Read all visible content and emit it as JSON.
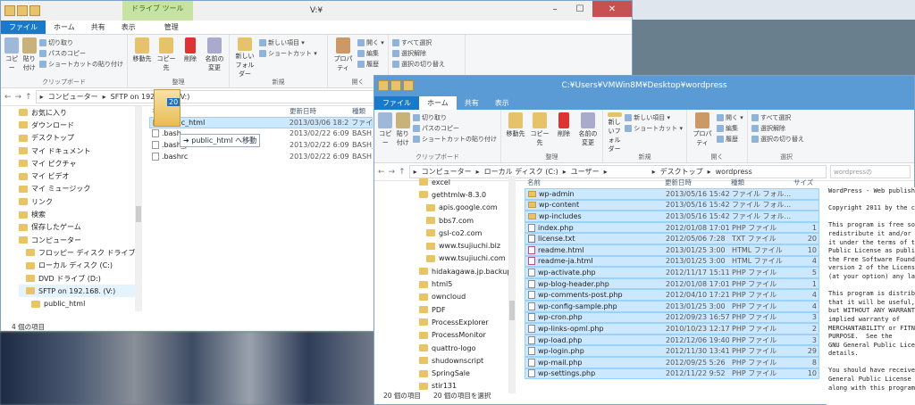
{
  "desktop_blur": "",
  "w1": {
    "title": "V:¥",
    "ctx_tab": "ドライブ ツール",
    "tabs": [
      "ファイル",
      "ホーム",
      "共有",
      "表示",
      "管理"
    ],
    "ribbon": {
      "copy": "コピー",
      "paste": "貼り付け",
      "cut": "切り取り",
      "copy_path": "パスのコピー",
      "paste_shortcut": "ショートカットの貼り付け",
      "move_to": "移動先",
      "copy_to": "コピー先",
      "delete": "削除",
      "rename": "名前の変更",
      "new_folder": "新しいフォルダー",
      "new_item": "新しい項目 ▾",
      "shortcut": "ショートカット ▾",
      "properties": "プロパティ",
      "open": "開く ▾",
      "edit": "編集",
      "history": "履歴",
      "select_all": "すべて選択",
      "select_none": "選択解除",
      "invert": "選択の切り替え",
      "grp_clipboard": "クリップボード",
      "grp_organize": "整理",
      "grp_new": "新規",
      "grp_open": "開く",
      "grp_select": "選択"
    },
    "path": [
      "コンピューター",
      "SFTP on 192.168.",
      "(V:)"
    ],
    "nav": [
      {
        "label": "お気に入り"
      },
      {
        "label": "ダウンロード"
      },
      {
        "label": "デスクトップ"
      },
      {
        "label": "マイ ドキュメント"
      },
      {
        "label": "マイ ピクチャ"
      },
      {
        "label": "マイ ビデオ"
      },
      {
        "label": "マイ ミュージック"
      },
      {
        "label": "リンク"
      },
      {
        "label": "検索"
      },
      {
        "label": "保存したゲーム"
      },
      {
        "label": "コンピューター"
      },
      {
        "label": "フロッピー ディスク ドライブ (A"
      },
      {
        "label": "ローカル ディスク (C:)"
      },
      {
        "label": "DVD ドライブ (D:)"
      },
      {
        "label": "SFTP on 192.168.       (V:)"
      },
      {
        "label": "public_html"
      }
    ],
    "cols": [
      "名前",
      "更新日時",
      "種類"
    ],
    "files": [
      {
        "name": "public_html",
        "date": "2013/03/06 18:20",
        "type": "ファイ",
        "kind": "folder",
        "sel": true
      },
      {
        "name": ".bash_",
        "date": "2013/02/22 6:09",
        "type": "BASH_",
        "kind": "file",
        "sel": false
      },
      {
        "name": ".bash_profile",
        "date": "2013/02/22 6:09",
        "type": "BASH_",
        "kind": "file",
        "sel": false
      },
      {
        "name": ".bashrc",
        "date": "2013/02/22 6:09",
        "type": "BASH",
        "kind": "file",
        "sel": false
      }
    ],
    "status": "4 個の項目",
    "drag_badge": "20",
    "drag_tip": "➜ public_html へ移動"
  },
  "w2": {
    "title": "C:¥Users¥VMWin8M¥Desktop¥wordpress",
    "tabs": [
      "ファイル",
      "ホーム",
      "共有",
      "表示"
    ],
    "path": [
      "コンピューター",
      "ローカル ディスク (C:)",
      "ユーザー",
      "",
      "デスクトップ",
      "wordpress"
    ],
    "search": "wordpressの",
    "cols": [
      "名前",
      "更新日時",
      "種類",
      "サイズ"
    ],
    "nav": [
      {
        "label": "excel"
      },
      {
        "label": "gethtmlw-8.3.0"
      },
      {
        "label": "apis.google.com"
      },
      {
        "label": "bbs7.com"
      },
      {
        "label": "gsl-co2.com"
      },
      {
        "label": "www.tsujiuchi.biz"
      },
      {
        "label": "www.tsujiuchi.com"
      },
      {
        "label": "hidakagawa.jp.backup"
      },
      {
        "label": "html5"
      },
      {
        "label": "owncloud"
      },
      {
        "label": "PDF"
      },
      {
        "label": "ProcessExplorer"
      },
      {
        "label": "ProcessMonitor"
      },
      {
        "label": "quattro-logo"
      },
      {
        "label": "shudownscript"
      },
      {
        "label": "SpringSale"
      },
      {
        "label": "stir131"
      }
    ],
    "files": [
      {
        "name": "wp-admin",
        "date": "2013/05/16 15:42",
        "type": "ファイル フォル...",
        "size": "",
        "kind": "folder"
      },
      {
        "name": "wp-content",
        "date": "2013/05/16 15:42",
        "type": "ファイル フォル...",
        "size": "",
        "kind": "folder"
      },
      {
        "name": "wp-includes",
        "date": "2013/05/16 15:42",
        "type": "ファイル フォル...",
        "size": "",
        "kind": "folder"
      },
      {
        "name": "index.php",
        "date": "2012/01/08 17:01",
        "type": "PHP ファイル",
        "size": "1",
        "kind": "php"
      },
      {
        "name": "license.txt",
        "date": "2012/05/06 7:28",
        "type": "TXT ファイル",
        "size": "20",
        "kind": "txt"
      },
      {
        "name": "readme.html",
        "date": "2013/01/25 3:00",
        "type": "HTML ファイル",
        "size": "10",
        "kind": "html"
      },
      {
        "name": "readme-ja.html",
        "date": "2013/01/25 3:00",
        "type": "HTML ファイル",
        "size": "4",
        "kind": "html"
      },
      {
        "name": "wp-activate.php",
        "date": "2012/11/17 15:11",
        "type": "PHP ファイル",
        "size": "5",
        "kind": "php"
      },
      {
        "name": "wp-blog-header.php",
        "date": "2012/01/08 17:01",
        "type": "PHP ファイル",
        "size": "1",
        "kind": "php"
      },
      {
        "name": "wp-comments-post.php",
        "date": "2012/04/10 17:21",
        "type": "PHP ファイル",
        "size": "4",
        "kind": "php"
      },
      {
        "name": "wp-config-sample.php",
        "date": "2013/01/25 3:00",
        "type": "PHP ファイル",
        "size": "4",
        "kind": "php"
      },
      {
        "name": "wp-cron.php",
        "date": "2012/09/23 16:57",
        "type": "PHP ファイル",
        "size": "3",
        "kind": "php"
      },
      {
        "name": "wp-links-opml.php",
        "date": "2010/10/23 12:17",
        "type": "PHP ファイル",
        "size": "2",
        "kind": "php"
      },
      {
        "name": "wp-load.php",
        "date": "2012/12/06 19:40",
        "type": "PHP ファイル",
        "size": "3",
        "kind": "php"
      },
      {
        "name": "wp-login.php",
        "date": "2012/11/30 13:41",
        "type": "PHP ファイル",
        "size": "29",
        "kind": "php"
      },
      {
        "name": "wp-mail.php",
        "date": "2012/09/25 5:26",
        "type": "PHP ファイル",
        "size": "8",
        "kind": "php"
      },
      {
        "name": "wp-settings.php",
        "date": "2012/11/22 9:52",
        "type": "PHP ファイル",
        "size": "10",
        "kind": "php"
      }
    ],
    "status_count": "20 個の項目",
    "status_sel": "20 個の項目を選択"
  },
  "license_text": "WordPress - Web publish\n\nCopyright 2011 by the c\n\nThis program is free so\nredistribute it and/or\nit under the terms of t\nPublic License as publi\nthe Free Software Found\nversion 2 of the Licens\n(at your option) any la\n\nThis program is distrib\nthat it will be useful,\nbut WITHOUT ANY WARRANT\nimplied warranty of\nMERCHANTABILITY or FITN\nPURPOSE.  See the\nGNU General Public Lice\ndetails.\n\nYou should have receive\nGeneral Public License\nalong with this program"
}
